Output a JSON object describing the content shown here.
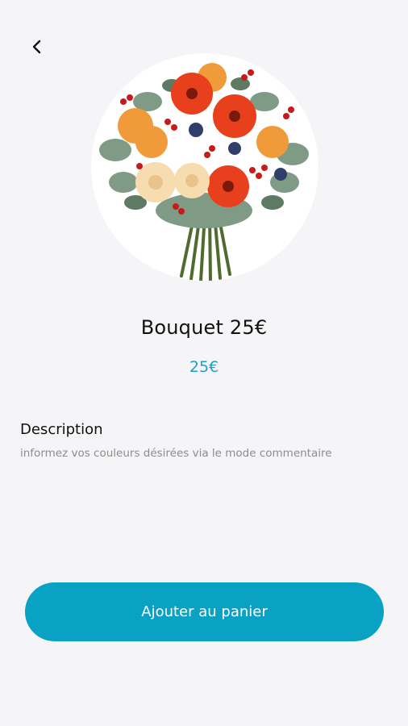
{
  "header": {
    "back_icon": "chevron-left-icon"
  },
  "product": {
    "image_alt": "flower-bouquet",
    "title": "Bouquet 25€",
    "price": "25€"
  },
  "description": {
    "label": "Description",
    "text": "informez vos couleurs désirées via le mode commentaire"
  },
  "actions": {
    "add_to_cart_label": "Ajouter au panier"
  },
  "colors": {
    "accent": "#0aa2c4",
    "price": "#1ea0c3",
    "background": "#f5f5f7"
  }
}
